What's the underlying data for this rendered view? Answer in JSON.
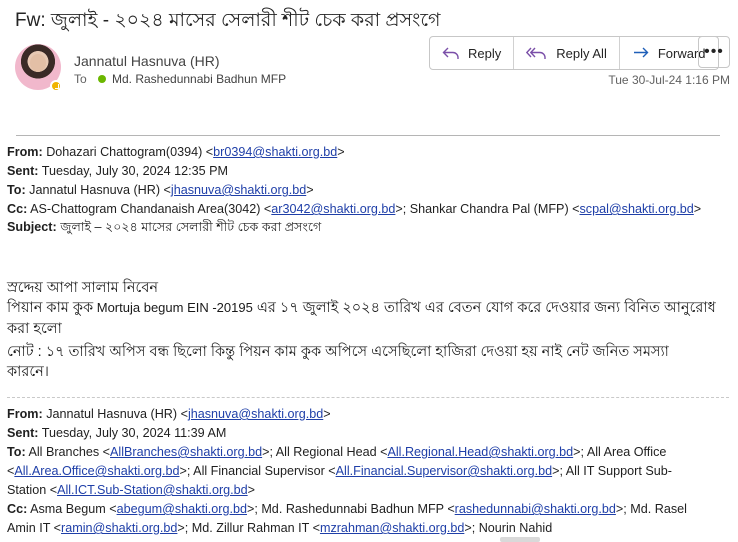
{
  "subject": "Fw:  জুলাই - ২০২৪ মাসের সেলারী শীট চেক করা প্রসংগে",
  "header": {
    "sender": "Jannatul Hasnuva (HR)",
    "to_label": "To",
    "to_recipient": "Md. Rashedunnabi Badhun MFP",
    "date": "Tue 30-Jul-24 1:16 PM",
    "buttons": {
      "reply": "Reply",
      "reply_all": "Reply All",
      "forward": "Forward"
    },
    "more": "•••"
  },
  "fwd1": {
    "from_label": "From:",
    "from_name": "Dohazari Chattogram(0394) <",
    "from_email": "br0394@shakti.org.bd",
    "from_end": ">",
    "sent_label": "Sent:",
    "sent": "Tuesday, July 30, 2024 12:35 PM",
    "to_label": "To:",
    "to_name": "Jannatul Hasnuva (HR) <",
    "to_email": "jhasnuva@shakti.org.bd",
    "to_end": ">",
    "cc_label": "Cc:",
    "cc1_name": "AS-Chattogram Chandanaish Area(3042) <",
    "cc1_email": "ar3042@shakti.org.bd",
    "cc_mid": ">; Shankar Chandra Pal (MFP) <",
    "cc2_email": "scpal@shakti.org.bd",
    "cc_end": ">",
    "subject_label": "Subject:",
    "subject": "জুলাই – ২০২৪ মাসের সেলারী শীট চেক করা প্রসংগে"
  },
  "message": {
    "greeting": "স্রদ্দেয় আপা সালাম নিবেন",
    "line1a": "পিয়ান কাম কুক",
    "line1b": " Mortuja begum  EIN -20195",
    "line1c": " এর ১৭ জুলাই ২০২৪ তারিখ এর বেতন যোগ করে দেওয়ার জন্য বিনিত আনুরোধ",
    "line2": "করা হলো",
    "line3": "নোট : ১৭ তারিখ অপিস বন্ধ ছিলো কিন্তু  পিয়ন কাম কুক অপিসে এসেছিলো হাজিরা দেওয়া হয় নাই নেট জনিত সমস্যা",
    "line4": "কারনে।"
  },
  "fwd2": {
    "from_label": "From:",
    "from_name": "Jannatul Hasnuva (HR) <",
    "from_email": "jhasnuva@shakti.org.bd",
    "from_end": ">",
    "sent_label": "Sent:",
    "sent": "Tuesday, July 30, 2024 11:39 AM",
    "to_label": "To:",
    "to_1": "All Branches <",
    "to_1_email": "AllBranches@shakti.org.bd",
    "to_2": ">; All Regional Head <",
    "to_2_email": "All.Regional.Head@shakti.org.bd",
    "to_3": ">; All Area Office",
    "to_4": "<",
    "to_4_email": "All.Area.Office@shakti.org.bd",
    "to_5": ">; All Financial Supervisor <",
    "to_5_email": "All.Financial.Supervisor@shakti.org.bd",
    "to_6": ">; All IT Support Sub-",
    "to_7": "Station <",
    "to_7_email": "All.ICT.Sub-Station@shakti.org.bd",
    "to_8": ">",
    "cc_label": "Cc:",
    "cc_1": "Asma Begum <",
    "cc_1_email": "abegum@shakti.org.bd",
    "cc_2": ">; Md. Rashedunnabi Badhun MFP <",
    "cc_2_email": "rashedunnabi@shakti.org.bd",
    "cc_3": ">; Md. Rasel",
    "cc_4": "Amin IT <",
    "cc_4_email": "ramin@shakti.org.bd",
    "cc_5": ">; Md. Zillur Rahman IT <",
    "cc_5_email": "mzrahman@shakti.org.bd",
    "cc_6": ">; Nourin Nahid"
  }
}
